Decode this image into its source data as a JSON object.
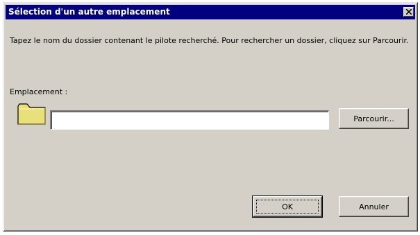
{
  "dialog": {
    "title": "Sélection d'un autre emplacement",
    "instructions": "Tapez le nom du dossier contenant le pilote recherché. Pour rechercher un dossier, cliquez sur Parcourir.",
    "location": {
      "label": "Emplacement :",
      "value": "",
      "browse_label": "Parcourir..."
    },
    "ok_label": "OK",
    "cancel_label": "Annuler"
  },
  "icons": {
    "close": "close-icon",
    "folder": "folder-icon"
  },
  "colors": {
    "titlebar": "#000080",
    "face": "#d4d0c8",
    "folder": "#e8e07a"
  }
}
